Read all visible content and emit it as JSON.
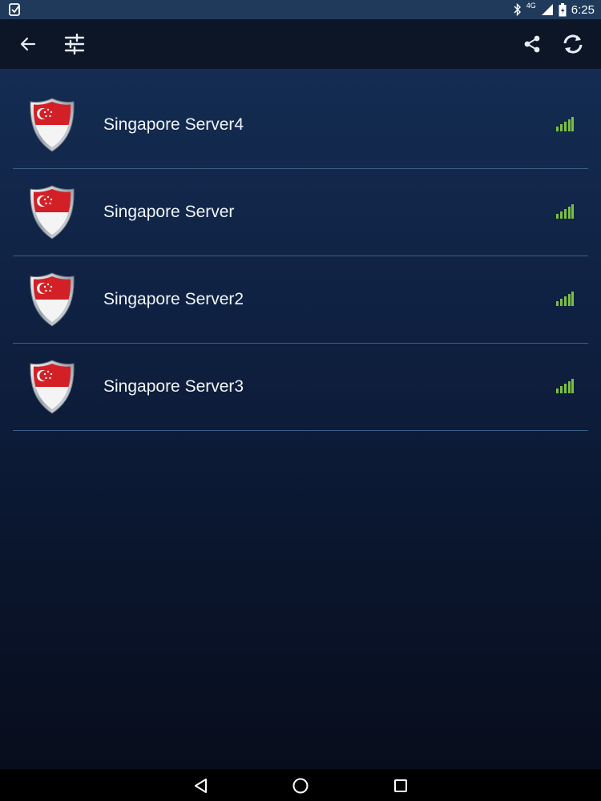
{
  "status_bar": {
    "time": "6:25",
    "network": "4G",
    "icons": [
      "app-notification-icon",
      "bluetooth-icon",
      "signal-icon",
      "battery-icon"
    ]
  },
  "toolbar": {
    "icons": [
      "back-arrow-icon",
      "filter-sliders-icon",
      "share-icon",
      "refresh-icon"
    ]
  },
  "servers": [
    {
      "name": "Singapore Server4",
      "flag": "singapore-flag-shield-icon",
      "signal": "signal-strength-icon"
    },
    {
      "name": "Singapore Server",
      "flag": "singapore-flag-shield-icon",
      "signal": "signal-strength-icon"
    },
    {
      "name": "Singapore Server2",
      "flag": "singapore-flag-shield-icon",
      "signal": "signal-strength-icon"
    },
    {
      "name": "Singapore Server3",
      "flag": "singapore-flag-shield-icon",
      "signal": "signal-strength-icon"
    }
  ],
  "nav_bar": {
    "icons": [
      "back-triangle-icon",
      "home-circle-icon",
      "recents-square-icon"
    ]
  },
  "colors": {
    "status_bar": "#1f3a5b",
    "toolbar": "#0c1626",
    "divider": "#3a5f86",
    "signal_green": "#7bc043",
    "flag_red": "#d32027"
  }
}
